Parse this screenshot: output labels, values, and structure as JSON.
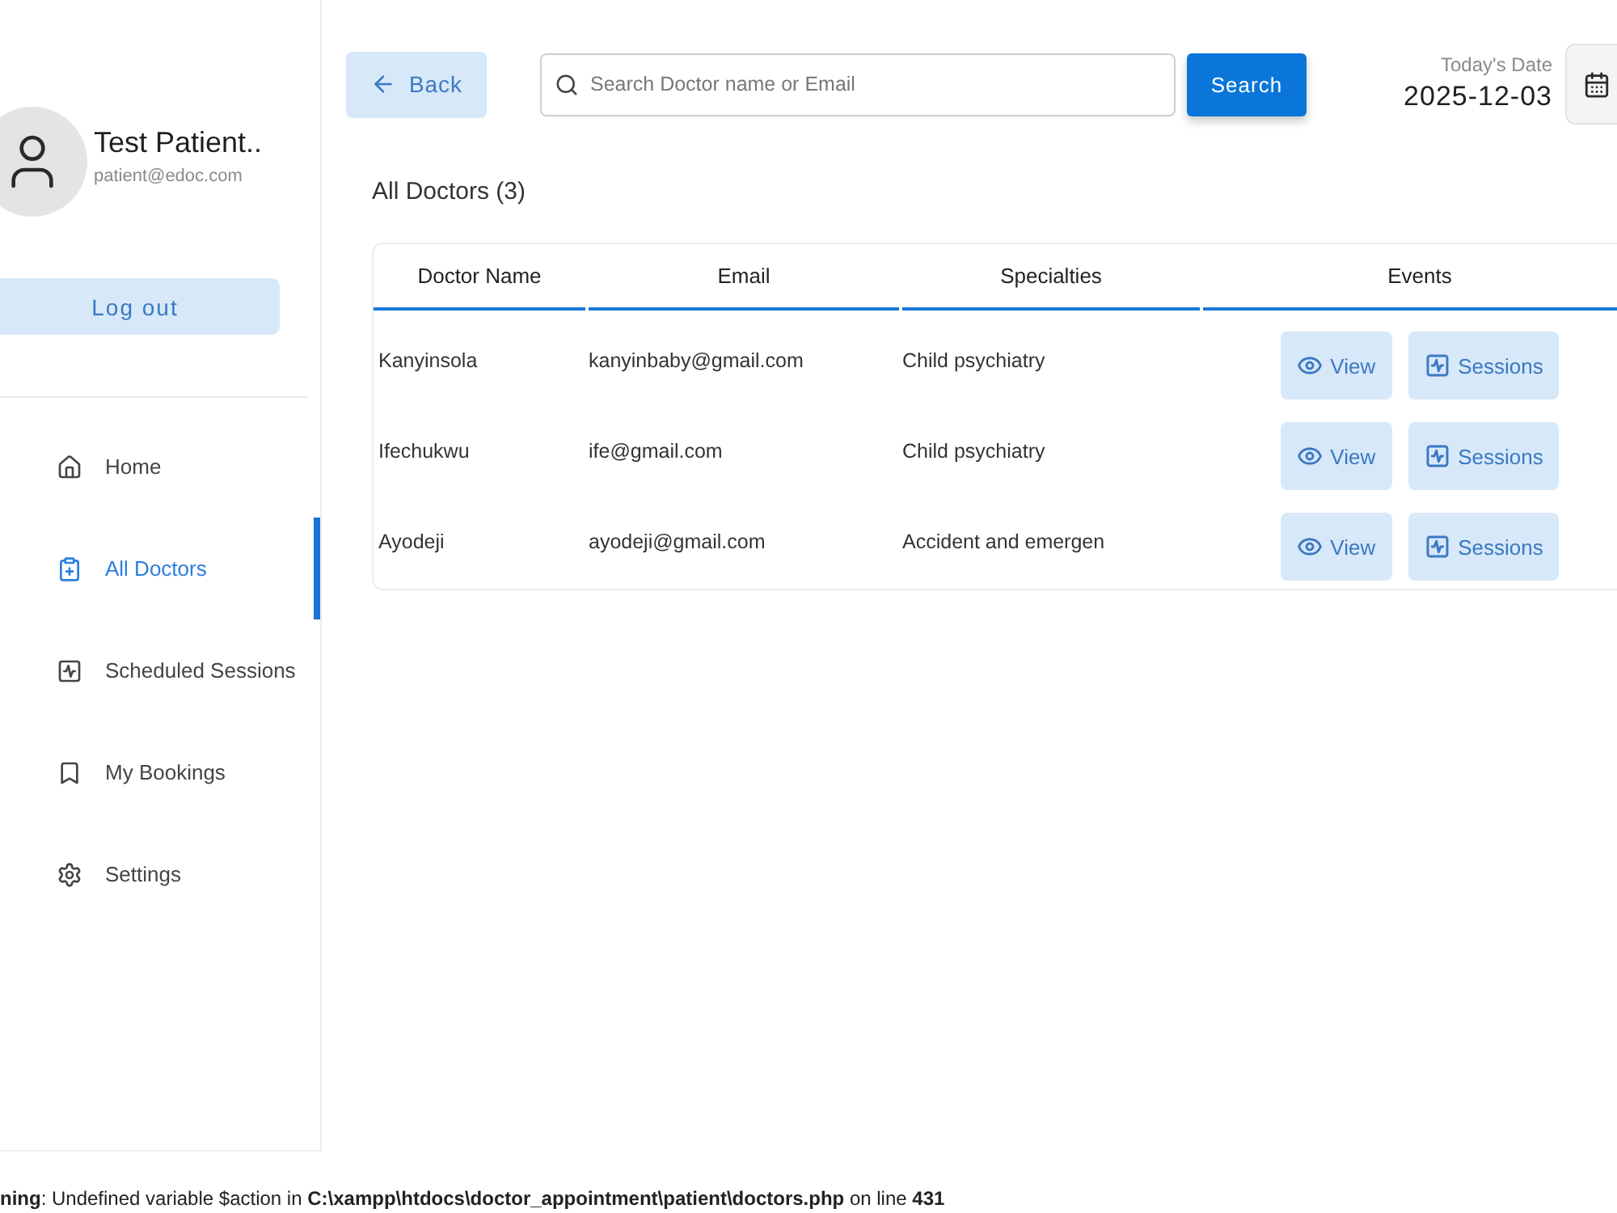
{
  "sidebar": {
    "profile": {
      "name": "Test Patient..",
      "email": "patient@edoc.com"
    },
    "logout_button": "Log out",
    "items": [
      {
        "label": "Home",
        "selected": false
      },
      {
        "label": "All Doctors",
        "selected": true
      },
      {
        "label": "Scheduled Sessions",
        "selected": false
      },
      {
        "label": "My Bookings",
        "selected": false
      },
      {
        "label": "Settings",
        "selected": false
      }
    ]
  },
  "toolbar": {
    "back_button": "Back",
    "search": {
      "placeholder": "Search Doctor name or Email"
    },
    "search_button": "Search",
    "date_label": "Today's Date",
    "date": "2025-12-03"
  },
  "heading": "All Doctors (3)",
  "table": {
    "columns": [
      "Doctor Name",
      "Email",
      "Specialties",
      "Events"
    ],
    "rows": [
      {
        "name": "Kanyinsola",
        "email": "kanyinbaby@gmail.com",
        "specialty": "Child psychiatry",
        "actions": [
          "View",
          "Sessions"
        ]
      },
      {
        "name": "Ifechukwu",
        "email": "ife@gmail.com",
        "specialty": "Child psychiatry",
        "actions": [
          "View",
          "Sessions"
        ]
      },
      {
        "name": "Ayodeji",
        "email": "ayodeji@gmail.com",
        "specialty": "Accident and emergen",
        "actions": [
          "View",
          "Sessions"
        ]
      }
    ]
  },
  "warning": "**ning**: Undefined variable $action in **C:\\xampp\\htdocs\\doctor_appointment\\patient\\doctors.php** on line **431**"
}
